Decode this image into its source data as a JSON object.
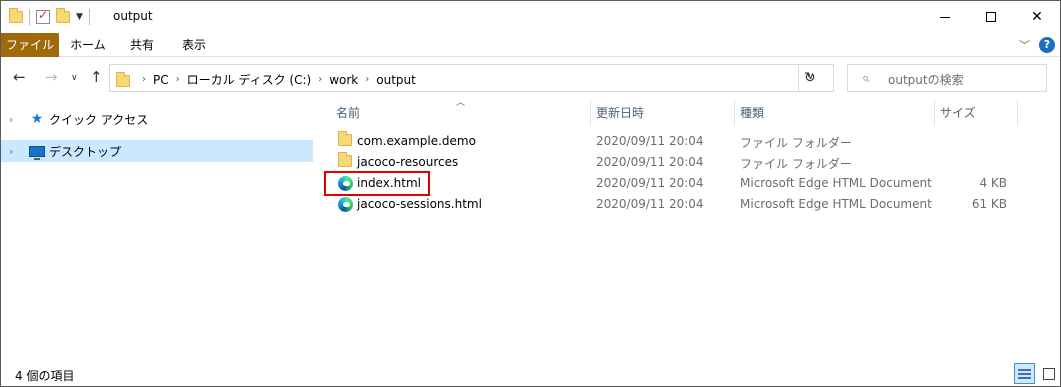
{
  "window": {
    "title": "output"
  },
  "ribbon": {
    "tabs": [
      {
        "label": "ファイル"
      },
      {
        "label": "ホーム"
      },
      {
        "label": "共有"
      },
      {
        "label": "表示"
      }
    ]
  },
  "address": {
    "crumbs": [
      "PC",
      "ローカル ディスク (C:)",
      "work",
      "output"
    ],
    "search_placeholder": "outputの検索"
  },
  "nav_pane": {
    "items": [
      {
        "label": "クイック アクセス",
        "icon": "star-icon"
      },
      {
        "label": "デスクトップ",
        "icon": "desktop-icon",
        "selected": true
      }
    ]
  },
  "file_list": {
    "columns": {
      "name": "名前",
      "date": "更新日時",
      "type": "種類",
      "size": "サイズ"
    },
    "rows": [
      {
        "name": "com.example.demo",
        "date": "2020/09/11 20:04",
        "type": "ファイル フォルダー",
        "size": "",
        "icon": "folder-icon"
      },
      {
        "name": "jacoco-resources",
        "date": "2020/09/11 20:04",
        "type": "ファイル フォルダー",
        "size": "",
        "icon": "folder-icon"
      },
      {
        "name": "index.html",
        "date": "2020/09/11 20:04",
        "type": "Microsoft Edge HTML Document",
        "size": "4 KB",
        "icon": "edge-icon",
        "highlighted": true
      },
      {
        "name": "jacoco-sessions.html",
        "date": "2020/09/11 20:04",
        "type": "Microsoft Edge HTML Document",
        "size": "61 KB",
        "icon": "edge-icon"
      }
    ]
  },
  "status": {
    "item_count": "4 個の項目"
  },
  "colors": {
    "file_tab": "#a06a0c",
    "selection": "#cce8ff",
    "highlight_box": "#e00000"
  }
}
